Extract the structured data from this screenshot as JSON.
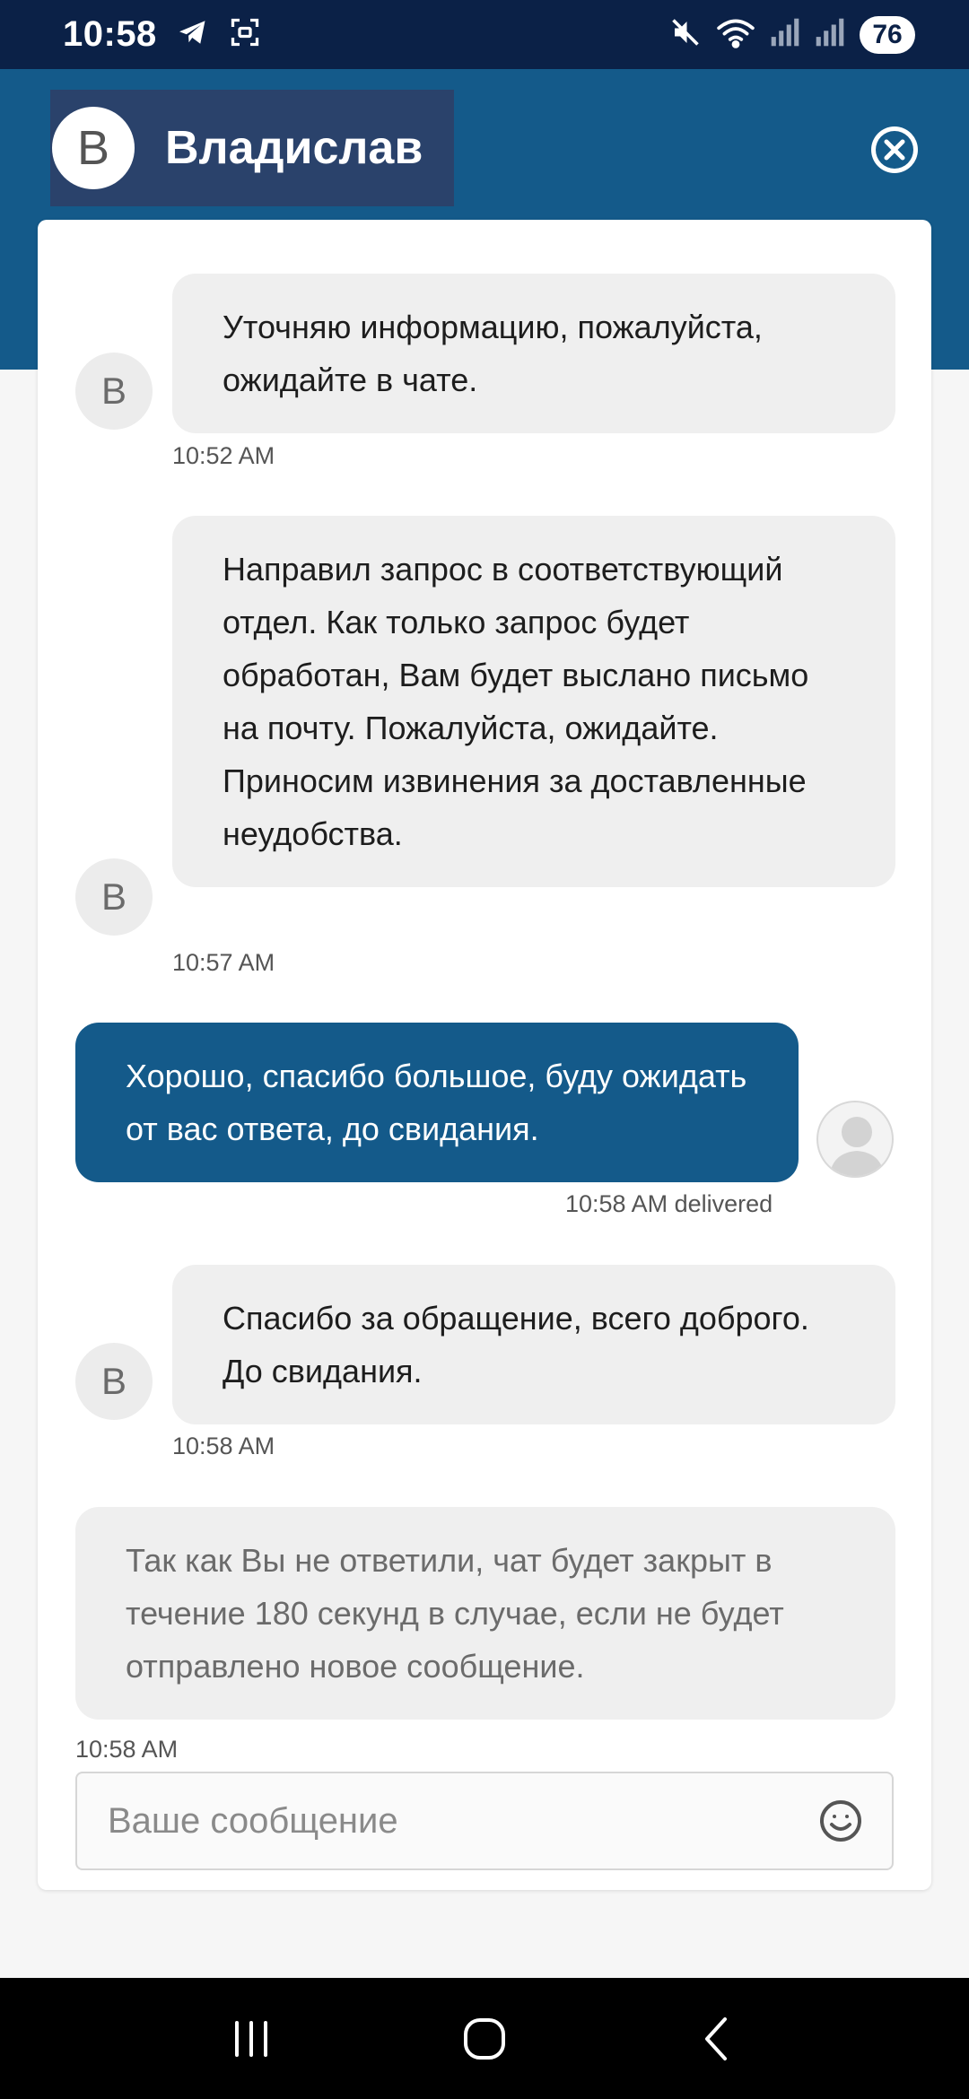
{
  "status_bar": {
    "time": "10:58",
    "battery": "76"
  },
  "header": {
    "agent_initial": "В",
    "agent_name": "Владислав"
  },
  "messages": [
    {
      "text": "Уточняю информацию, пожалуйста, ожидайте в чате.",
      "avatar": "В",
      "time": "10:52 AM"
    },
    {
      "text": "Направил запрос в соответствующий отдел. Как только запрос будет обработан, Вам будет выслано письмо на почту. Пожалуйста, ожидайте. Приносим извинения за доставленные неудобства.",
      "avatar": "В",
      "time": "10:57 AM"
    },
    {
      "text": "Хорошо, спасибо большое, буду ожидать от вас ответа, до свидания.",
      "time": "10:58 AM delivered"
    },
    {
      "text": "Спасибо за обращение, всего доброго. До свидания.",
      "avatar": "В",
      "time": "10:58 AM"
    },
    {
      "text": "Так как Вы не ответили, чат будет закрыт в течение 180 секунд в случае, если не будет отправлено новое сообщение.",
      "time": "10:58 AM"
    }
  ],
  "input": {
    "placeholder": "Ваше сообщение"
  },
  "icons": {
    "telegram": "telegram-icon",
    "screenshot": "screenshot-icon",
    "mute": "mute-icon",
    "wifi": "wifi-icon",
    "signal": "signal-icon",
    "close": "close-icon",
    "emoji": "emoji-icon",
    "recents": "recents-icon",
    "home": "home-icon",
    "back": "back-icon"
  },
  "colors": {
    "brand": "#145a8a",
    "status_bar": "#0b2147",
    "agent_header": "#2a426b",
    "bubble_gray": "#efefef"
  }
}
